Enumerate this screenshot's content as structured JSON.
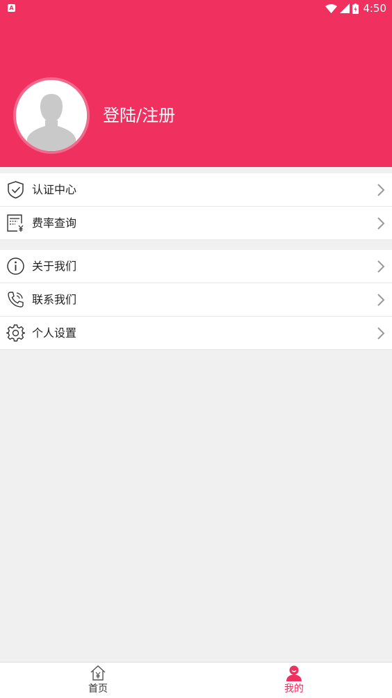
{
  "status_bar": {
    "time": "4:50",
    "notification_letter": "A"
  },
  "header": {
    "login_label": "登陆/注册",
    "accent_color": "#f0305f"
  },
  "menu_group_1": [
    {
      "label": "认证中心",
      "icon": "shield-check-icon"
    },
    {
      "label": "费率查询",
      "icon": "rate-bill-icon"
    }
  ],
  "menu_group_2": [
    {
      "label": "关于我们",
      "icon": "info-icon"
    },
    {
      "label": "联系我们",
      "icon": "phone-icon"
    },
    {
      "label": "个人设置",
      "icon": "gear-icon"
    }
  ],
  "tabbar": {
    "home_label": "首页",
    "mine_label": "我的",
    "active_tab": "mine"
  }
}
